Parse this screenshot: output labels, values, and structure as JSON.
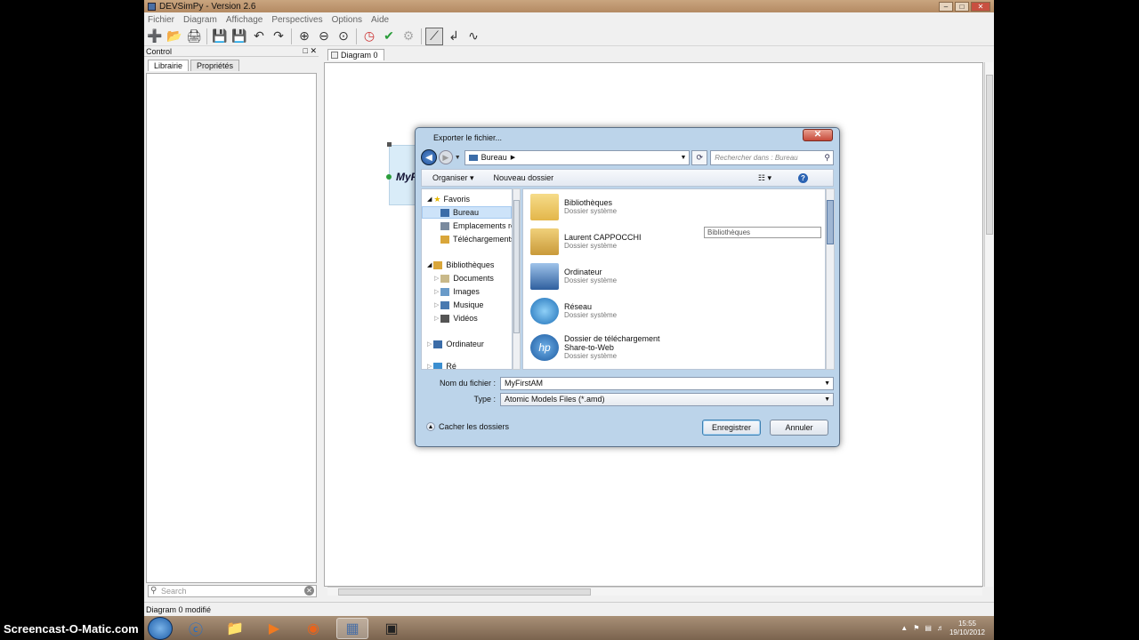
{
  "app": {
    "title": "DEVSimPy - Version 2.6",
    "menu": [
      "Fichier",
      "Diagram",
      "Affichage",
      "Perspectives",
      "Options",
      "Aide"
    ],
    "control_title": "Control",
    "control_buttons": "□ ✕",
    "tabs": [
      "Librairie",
      "Propriétés"
    ],
    "search_placeholder": "Search",
    "diagram_tab": "Diagram 0",
    "block_label": "MyF",
    "status": "Diagram 0 modifié"
  },
  "dialog": {
    "title": "Exporter le fichier...",
    "close": "✕",
    "address": "Bureau",
    "search_placeholder": "Rechercher dans : Bureau",
    "commands": [
      "Organiser ▾",
      "Nouveau dossier"
    ],
    "view_icon": "☷ ▾",
    "help": "?",
    "nav": [
      {
        "label": "Favoris",
        "icon": "star-icon",
        "color": "#e6b800"
      },
      {
        "label": "Bureau",
        "icon": "desktop-icon",
        "color": "#3b6ca8"
      },
      {
        "label": "Emplacements ré",
        "icon": "places-icon",
        "color": "#7a8a9e"
      },
      {
        "label": "Téléchargements",
        "icon": "downloads-icon",
        "color": "#d9a63a"
      },
      {
        "label": "Bibliothèques",
        "icon": "libraries-icon",
        "color": "#d9a63a"
      },
      {
        "label": "Documents",
        "icon": "documents-icon",
        "color": "#c9b98a"
      },
      {
        "label": "Images",
        "icon": "images-icon",
        "color": "#6a9bc9"
      },
      {
        "label": "Musique",
        "icon": "music-icon",
        "color": "#4a7ab0"
      },
      {
        "label": "Vidéos",
        "icon": "videos-icon",
        "color": "#555"
      },
      {
        "label": "Ordinateur",
        "icon": "computer-icon",
        "color": "#3b6ca8"
      },
      {
        "label": "Ré",
        "icon": "network-icon",
        "color": "#3b8ed0"
      }
    ],
    "files": [
      {
        "name": "Bibliothèques",
        "sub": "Dossier système",
        "icon": "libraries-folder-icon",
        "color": "#e8c560"
      },
      {
        "name": "Laurent CAPPOCCHI",
        "sub": "Dossier système",
        "icon": "user-folder-icon",
        "color": "#d9b050"
      },
      {
        "name": "Ordinateur",
        "sub": "Dossier système",
        "icon": "computer-icon",
        "color": "#3b6ca8"
      },
      {
        "name": "Réseau",
        "sub": "Dossier système",
        "icon": "network-globe-icon",
        "color": "#2f8ad4"
      },
      {
        "name": "Dossier de téléchargement\nShare-to-Web",
        "sub": "Dossier système",
        "icon": "hp-share-icon",
        "color": "#1c6fb8"
      }
    ],
    "tooltip": "Bibliothèques",
    "filename_label": "Nom du fichier :",
    "filename_value": "MyFirstAM",
    "type_label": "Type :",
    "type_value": "Atomic Models Files (*.amd)",
    "hide_folders": "Cacher les dossiers",
    "save": "Enregistrer",
    "cancel": "Annuler"
  },
  "taskbar": {
    "time": "15:55",
    "date": "19/10/2012"
  },
  "watermark": "Screencast-O-Matic.com"
}
